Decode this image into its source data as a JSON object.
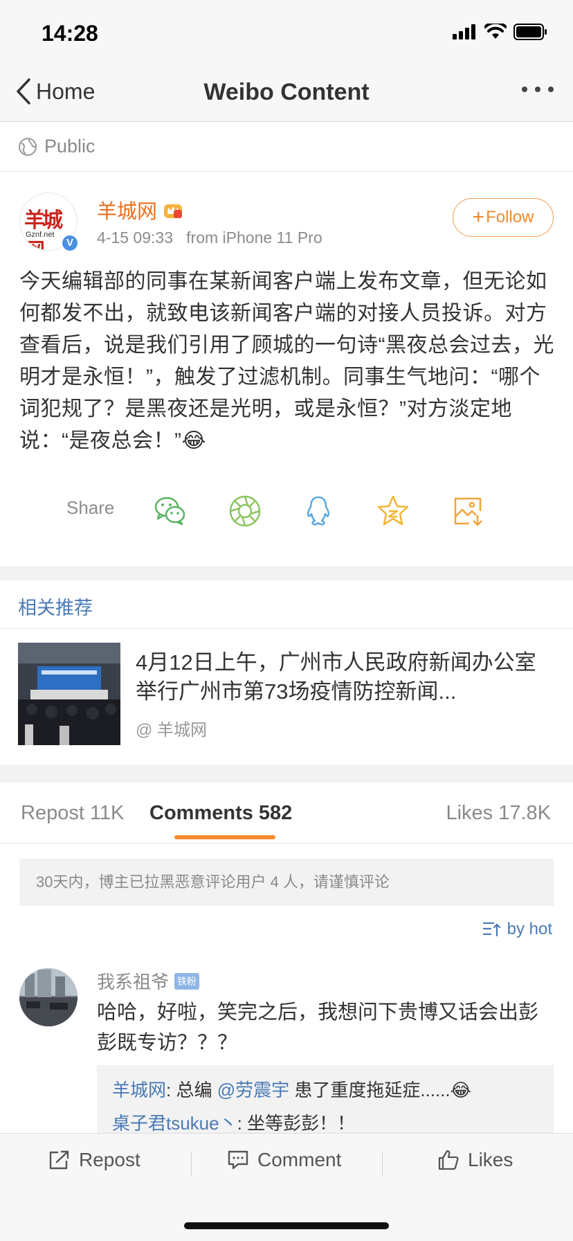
{
  "status_bar": {
    "time": "14:28"
  },
  "nav": {
    "back_label": "Home",
    "title": "Weibo Content"
  },
  "visibility": {
    "label": "Public"
  },
  "post": {
    "author": "羊城网",
    "avatar_text": "羊城网",
    "avatar_subtext": "Gznf.net",
    "verified_mark": "V",
    "time": "4-15 09:33",
    "source": "from iPhone 11 Pro",
    "follow_label": "Follow",
    "text": "今天编辑部的同事在某新闻客户端上发布文章，但无论如何都发不出，就致电该新闻客户端的对接人员投诉。对方查看后，说是我们引用了顾城的一句诗“黑夜总会过去，光明才是永恒！”，触发了过滤机制。同事生气地问：“哪个词犯规了？是黑夜还是光明，或是永恒？”对方淡定地说：“是夜总会！”😂"
  },
  "share": {
    "label": "Share",
    "targets": [
      "wechat-icon",
      "moments-icon",
      "qq-icon",
      "favorite-icon",
      "save-image-icon"
    ]
  },
  "related": {
    "header": "相关推荐",
    "title": "4月12日上午，广州市人民政府新闻办公室举行广州市第73场疫情防控新闻...",
    "source": "@ 羊城网"
  },
  "tabs": {
    "repost": "Repost 11K",
    "comments": "Comments 582",
    "likes": "Likes 17.8K",
    "active": "comments"
  },
  "notice": "30天内，博主已拉黑恶意评论用户 4 人，请谨慎评论",
  "sort_label": "by hot",
  "comment": {
    "user": "我系祖爷",
    "badge": "铁粉",
    "text": "哈哈，好啦，笑完之后，我想问下贵博又话会出彭彭既专访？？？",
    "replies": [
      {
        "user": "羊城网",
        "sep": ": 总编 ",
        "at": "@劳震宇",
        "text": " 患了重度拖延症......😂"
      },
      {
        "user": "桌子君tsukue丶",
        "sep": ": ",
        "text": "坐等彭彭！！"
      }
    ]
  },
  "bottom_bar": {
    "repost": "Repost",
    "comment": "Comment",
    "likes": "Likes"
  },
  "colors": {
    "accent_orange": "#f08a2b",
    "link_blue": "#4a7ab5",
    "name_orange": "#e86f1c"
  }
}
